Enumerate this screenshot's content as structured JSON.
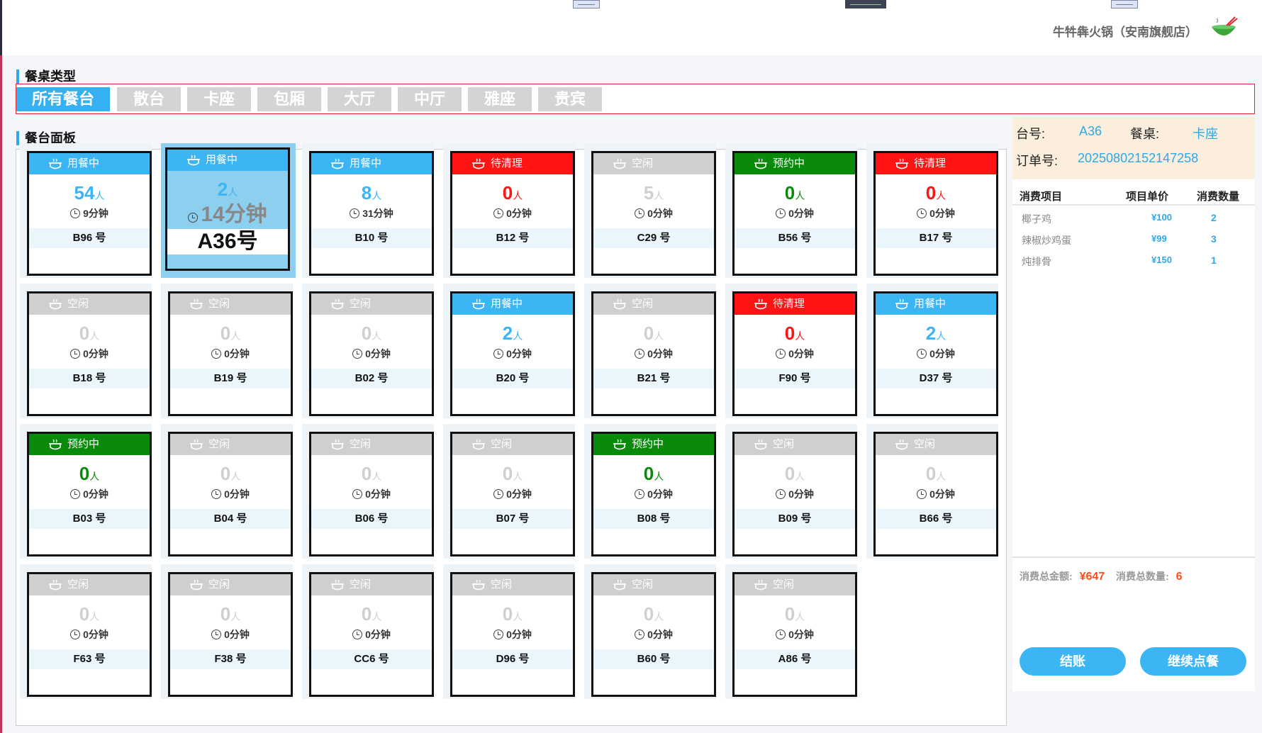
{
  "store": {
    "name": "牛牪犇火锅（安南旗舰店）"
  },
  "sections": {
    "type_label": "餐桌类型",
    "panel_label": "餐台面板"
  },
  "tabs": [
    "所有餐台",
    "散台",
    "卡座",
    "包厢",
    "大厅",
    "中厅",
    "雅座",
    "贵宾"
  ],
  "tables": [
    {
      "status": "busy",
      "label": "用餐中",
      "people": "54",
      "time": "9分钟",
      "name": "B96 号"
    },
    {
      "status": "busy",
      "label": "用餐中",
      "people": "2",
      "time": "14分钟",
      "name": "A36号",
      "selected": true
    },
    {
      "status": "busy",
      "label": "用餐中",
      "people": "8",
      "time": "31分钟",
      "name": "B10 号"
    },
    {
      "status": "clean",
      "label": "待清理",
      "people": "0",
      "time": "0分钟",
      "name": "B12 号"
    },
    {
      "status": "idle",
      "label": "空闲",
      "people": "5",
      "time": "0分钟",
      "name": "C29 号"
    },
    {
      "status": "reserved",
      "label": "预约中",
      "people": "0",
      "time": "0分钟",
      "name": "B56 号"
    },
    {
      "status": "clean",
      "label": "待清理",
      "people": "0",
      "time": "0分钟",
      "name": "B17 号"
    },
    {
      "status": "idle",
      "label": "空闲",
      "people": "0",
      "time": "0分钟",
      "name": "B18 号"
    },
    {
      "status": "idle",
      "label": "空闲",
      "people": "0",
      "time": "0分钟",
      "name": "B19 号"
    },
    {
      "status": "idle",
      "label": "空闲",
      "people": "0",
      "time": "0分钟",
      "name": "B02 号"
    },
    {
      "status": "busy",
      "label": "用餐中",
      "people": "2",
      "time": "0分钟",
      "name": "B20 号"
    },
    {
      "status": "idle",
      "label": "空闲",
      "people": "0",
      "time": "0分钟",
      "name": "B21 号"
    },
    {
      "status": "clean",
      "label": "待清理",
      "people": "0",
      "time": "0分钟",
      "name": "F90 号"
    },
    {
      "status": "busy",
      "label": "用餐中",
      "people": "2",
      "time": "0分钟",
      "name": "D37 号"
    },
    {
      "status": "reserved",
      "label": "预约中",
      "people": "0",
      "time": "0分钟",
      "name": "B03 号"
    },
    {
      "status": "idle",
      "label": "空闲",
      "people": "0",
      "time": "0分钟",
      "name": "B04 号"
    },
    {
      "status": "idle",
      "label": "空闲",
      "people": "0",
      "time": "0分钟",
      "name": "B06 号"
    },
    {
      "status": "idle",
      "label": "空闲",
      "people": "0",
      "time": "0分钟",
      "name": "B07 号"
    },
    {
      "status": "reserved",
      "label": "预约中",
      "people": "0",
      "time": "0分钟",
      "name": "B08 号"
    },
    {
      "status": "idle",
      "label": "空闲",
      "people": "0",
      "time": "0分钟",
      "name": "B09 号"
    },
    {
      "status": "idle",
      "label": "空闲",
      "people": "0",
      "time": "0分钟",
      "name": "B66 号"
    },
    {
      "status": "idle",
      "label": "空闲",
      "people": "0",
      "time": "0分钟",
      "name": "F63 号"
    },
    {
      "status": "idle",
      "label": "空闲",
      "people": "0",
      "time": "0分钟",
      "name": "F38 号"
    },
    {
      "status": "idle",
      "label": "空闲",
      "people": "0",
      "time": "0分钟",
      "name": "CC6 号"
    },
    {
      "status": "idle",
      "label": "空闲",
      "people": "0",
      "time": "0分钟",
      "name": "D96 号"
    },
    {
      "status": "idle",
      "label": "空闲",
      "people": "0",
      "time": "0分钟",
      "name": "B60 号"
    },
    {
      "status": "idle",
      "label": "空闲",
      "people": "0",
      "time": "0分钟",
      "name": "A86 号"
    }
  ],
  "people_unit": "人",
  "detail": {
    "table_label": "台号:",
    "table_no": "A36",
    "type_label": "餐桌:",
    "type_value": "卡座",
    "order_label": "订单号:",
    "order_no": "20250802152147258",
    "columns": [
      "消费项目",
      "项目单价",
      "消费数量"
    ],
    "items": [
      {
        "name": "椰子鸡",
        "price": "¥100",
        "qty": "2"
      },
      {
        "name": "辣椒炒鸡蛋",
        "price": "¥99",
        "qty": "3"
      },
      {
        "name": "炖排骨",
        "price": "¥150",
        "qty": "1"
      }
    ],
    "total_amount_label": "消费总金额:",
    "total_amount": "¥647",
    "total_qty_label": "消费总数量:",
    "total_qty": "6",
    "checkout_label": "结账",
    "continue_label": "继续点餐"
  },
  "colors": {
    "accent": "#3cb5f5",
    "busy": "#3cb5f5",
    "clean": "#ff1313",
    "reserved": "#0a8a0a",
    "idle": "#cfcfcf",
    "highlight": "#ff4d16"
  },
  "icons": {
    "card_state": "hotpot-icon",
    "time": "clock-icon",
    "logo": "bowl-logo-icon"
  }
}
